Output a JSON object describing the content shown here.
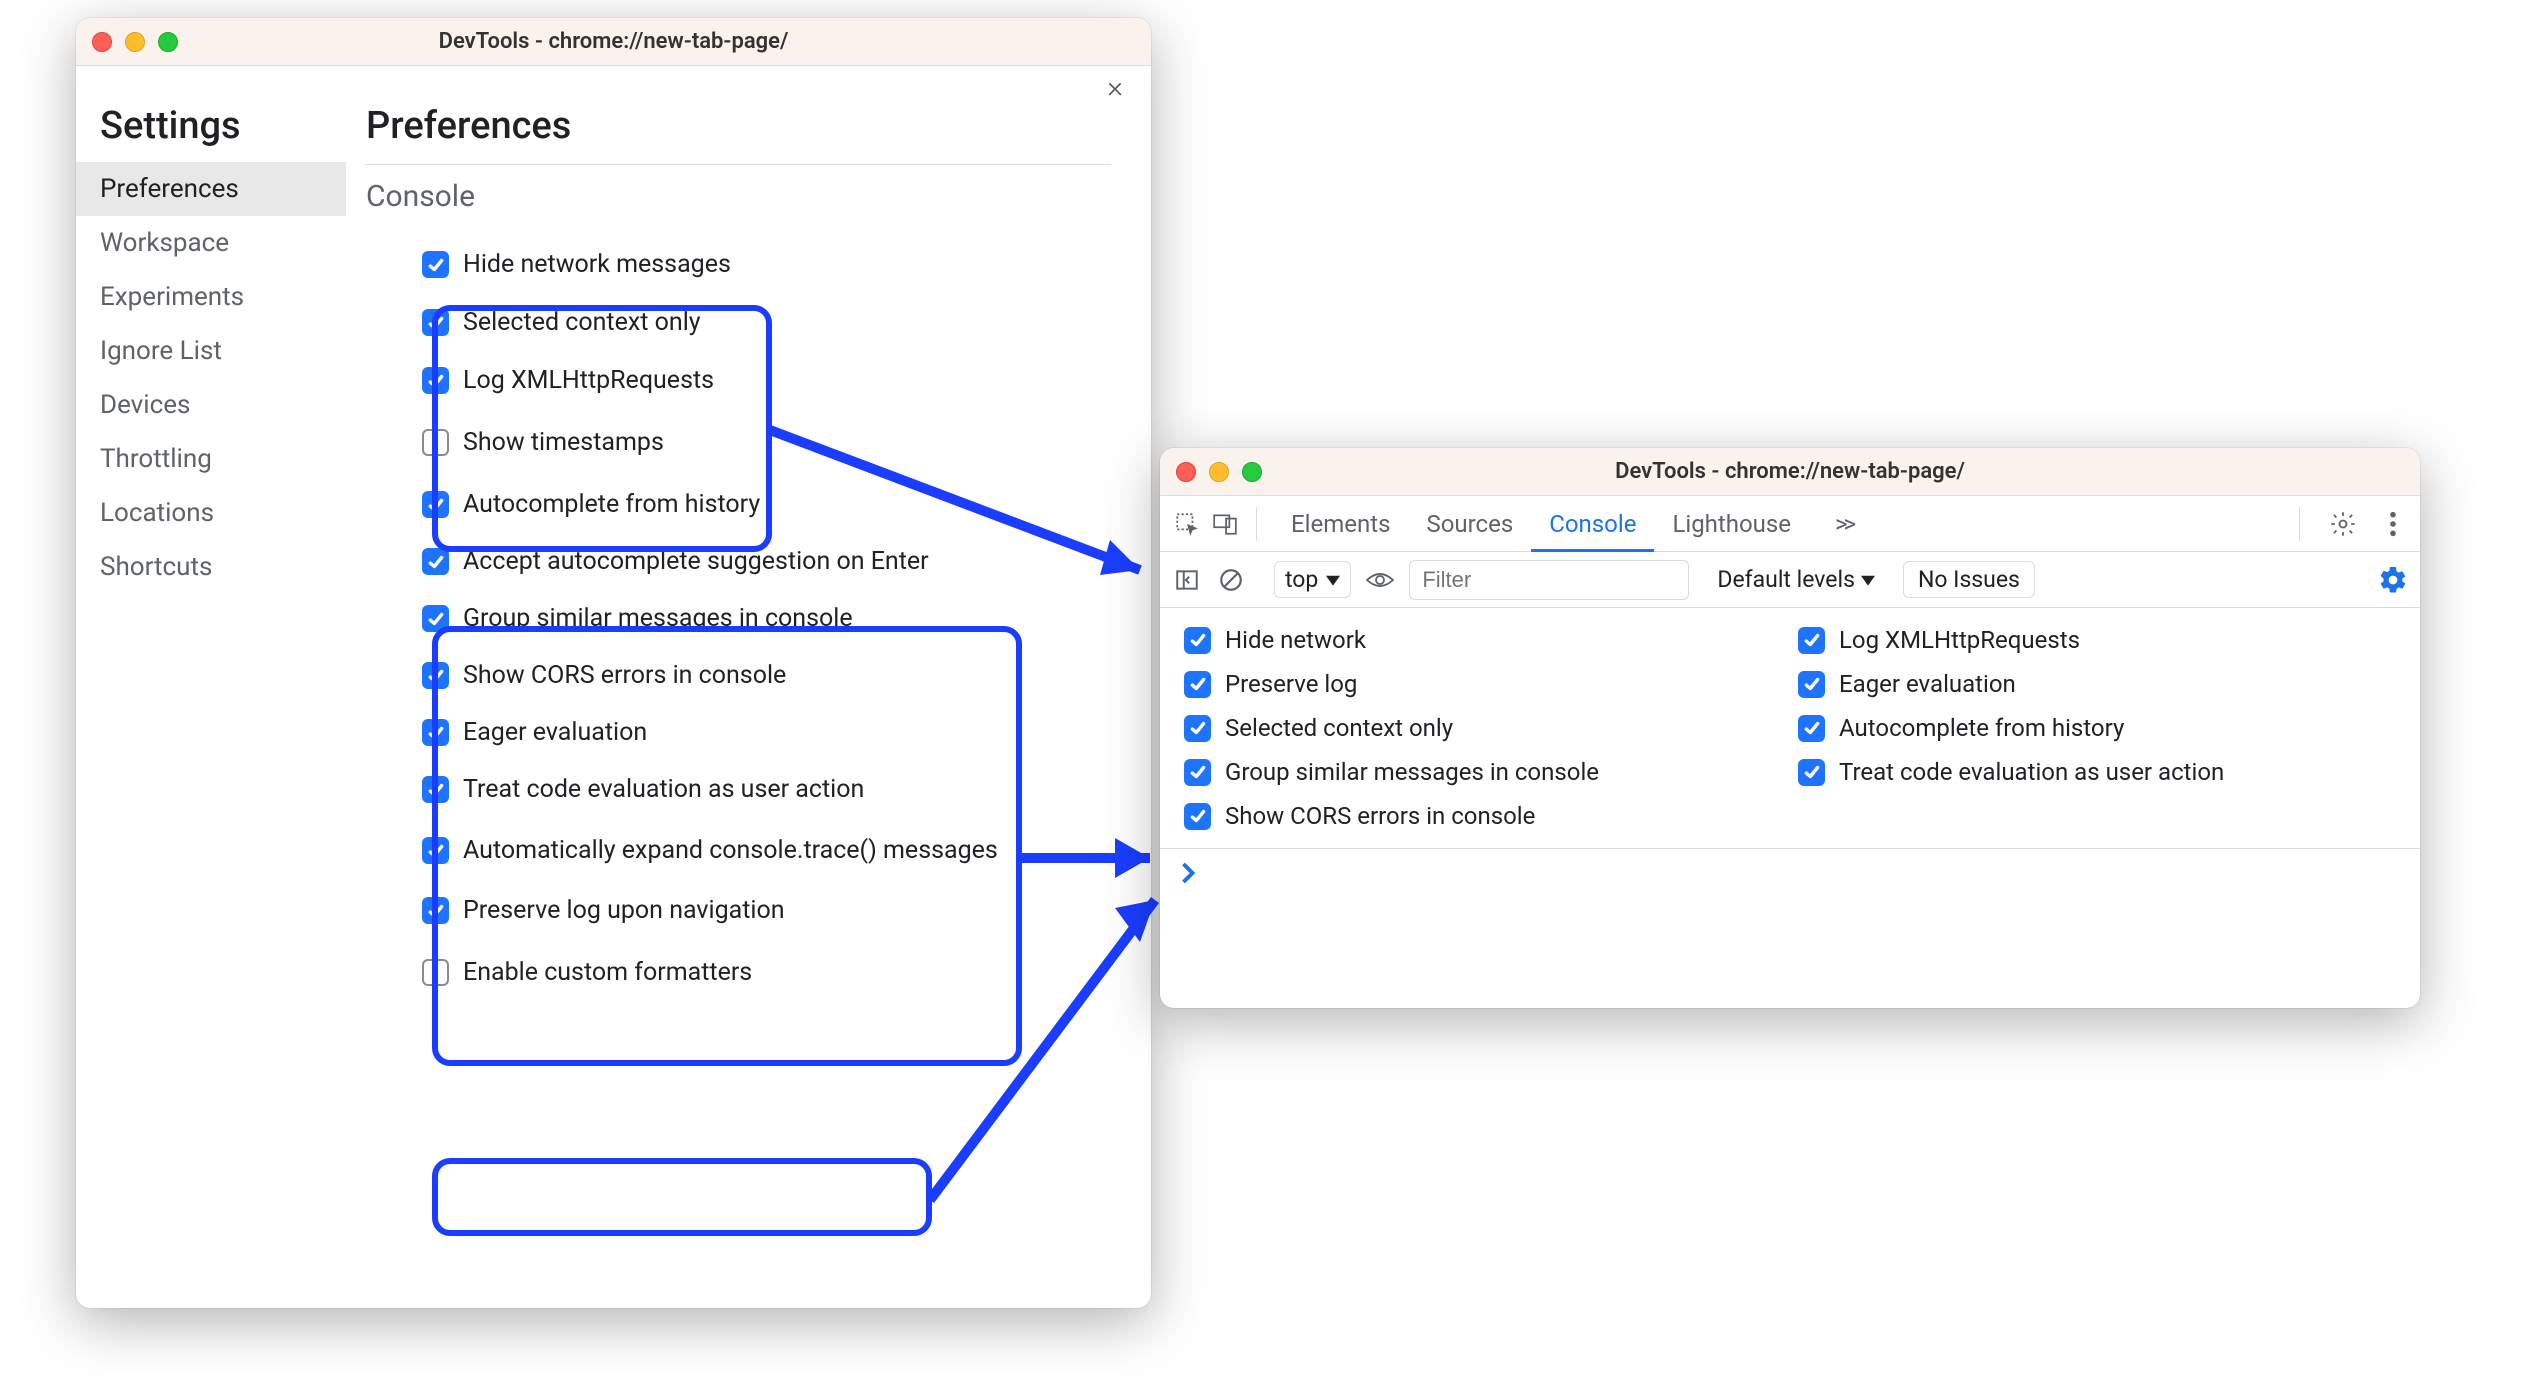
{
  "settingsWindow": {
    "title": "DevTools - chrome://new-tab-page/",
    "heading": "Settings",
    "nav": [
      {
        "label": "Preferences",
        "active": true
      },
      {
        "label": "Workspace"
      },
      {
        "label": "Experiments"
      },
      {
        "label": "Ignore List"
      },
      {
        "label": "Devices"
      },
      {
        "label": "Throttling"
      },
      {
        "label": "Locations"
      },
      {
        "label": "Shortcuts"
      }
    ],
    "prefsHeading": "Preferences",
    "sectionHeading": "Console",
    "checks": [
      {
        "label": "Hide network messages",
        "checked": true
      },
      {
        "label": "Selected context only",
        "checked": true
      },
      {
        "label": "Log XMLHttpRequests",
        "checked": true
      },
      {
        "label": "Show timestamps",
        "checked": false
      },
      {
        "label": "Autocomplete from history",
        "checked": true
      },
      {
        "label": "Accept autocomplete suggestion on Enter",
        "checked": true
      },
      {
        "label": "Group similar messages in console",
        "checked": true
      },
      {
        "label": "Show CORS errors in console",
        "checked": true
      },
      {
        "label": "Eager evaluation",
        "checked": true
      },
      {
        "label": "Treat code evaluation as user action",
        "checked": true
      },
      {
        "label": "Automatically expand console.trace() messages",
        "checked": true
      },
      {
        "label": "Preserve log upon navigation",
        "checked": true
      },
      {
        "label": "Enable custom formatters",
        "checked": false
      }
    ]
  },
  "consoleWindow": {
    "title": "DevTools - chrome://new-tab-page/",
    "tabs": [
      {
        "label": "Elements"
      },
      {
        "label": "Sources"
      },
      {
        "label": "Console",
        "active": true
      },
      {
        "label": "Lighthouse"
      }
    ],
    "moreTabsGlyph": ">>",
    "filterBar": {
      "context": "top",
      "filterPlaceholder": "Filter",
      "levelsLabel": "Default levels",
      "issuesLabel": "No Issues"
    },
    "settingsGrid": {
      "left": [
        {
          "label": "Hide network",
          "checked": true
        },
        {
          "label": "Preserve log",
          "checked": true
        },
        {
          "label": "Selected context only",
          "checked": true
        },
        {
          "label": "Group similar messages in console",
          "checked": true
        },
        {
          "label": "Show CORS errors in console",
          "checked": true
        }
      ],
      "right": [
        {
          "label": "Log XMLHttpRequests",
          "checked": true
        },
        {
          "label": "Eager evaluation",
          "checked": true
        },
        {
          "label": "Autocomplete from history",
          "checked": true
        },
        {
          "label": "Treat code evaluation as user action",
          "checked": true
        }
      ]
    }
  }
}
